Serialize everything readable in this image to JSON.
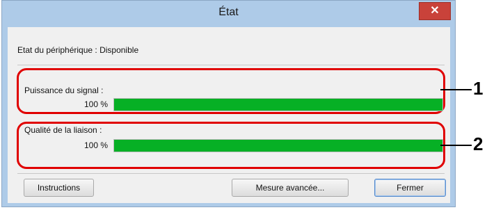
{
  "window": {
    "title": "État",
    "close_glyph": "✕"
  },
  "status": {
    "text": "Etat du périphérique : Disponible"
  },
  "signal": {
    "label": "Puissance du signal :",
    "percent_text": "100 %",
    "level_fraction": 1.0
  },
  "link_quality": {
    "label": "Qualité de la liaison :",
    "percent_text": "100 %",
    "level_fraction": 1.0
  },
  "buttons": {
    "instructions": "Instructions",
    "advanced": "Mesure avancée...",
    "close": "Fermer"
  },
  "callouts": {
    "one": "1",
    "two": "2"
  },
  "colors": {
    "bar_fill": "#06b025",
    "highlight": "#e00000",
    "close_button": "#c9423a"
  }
}
